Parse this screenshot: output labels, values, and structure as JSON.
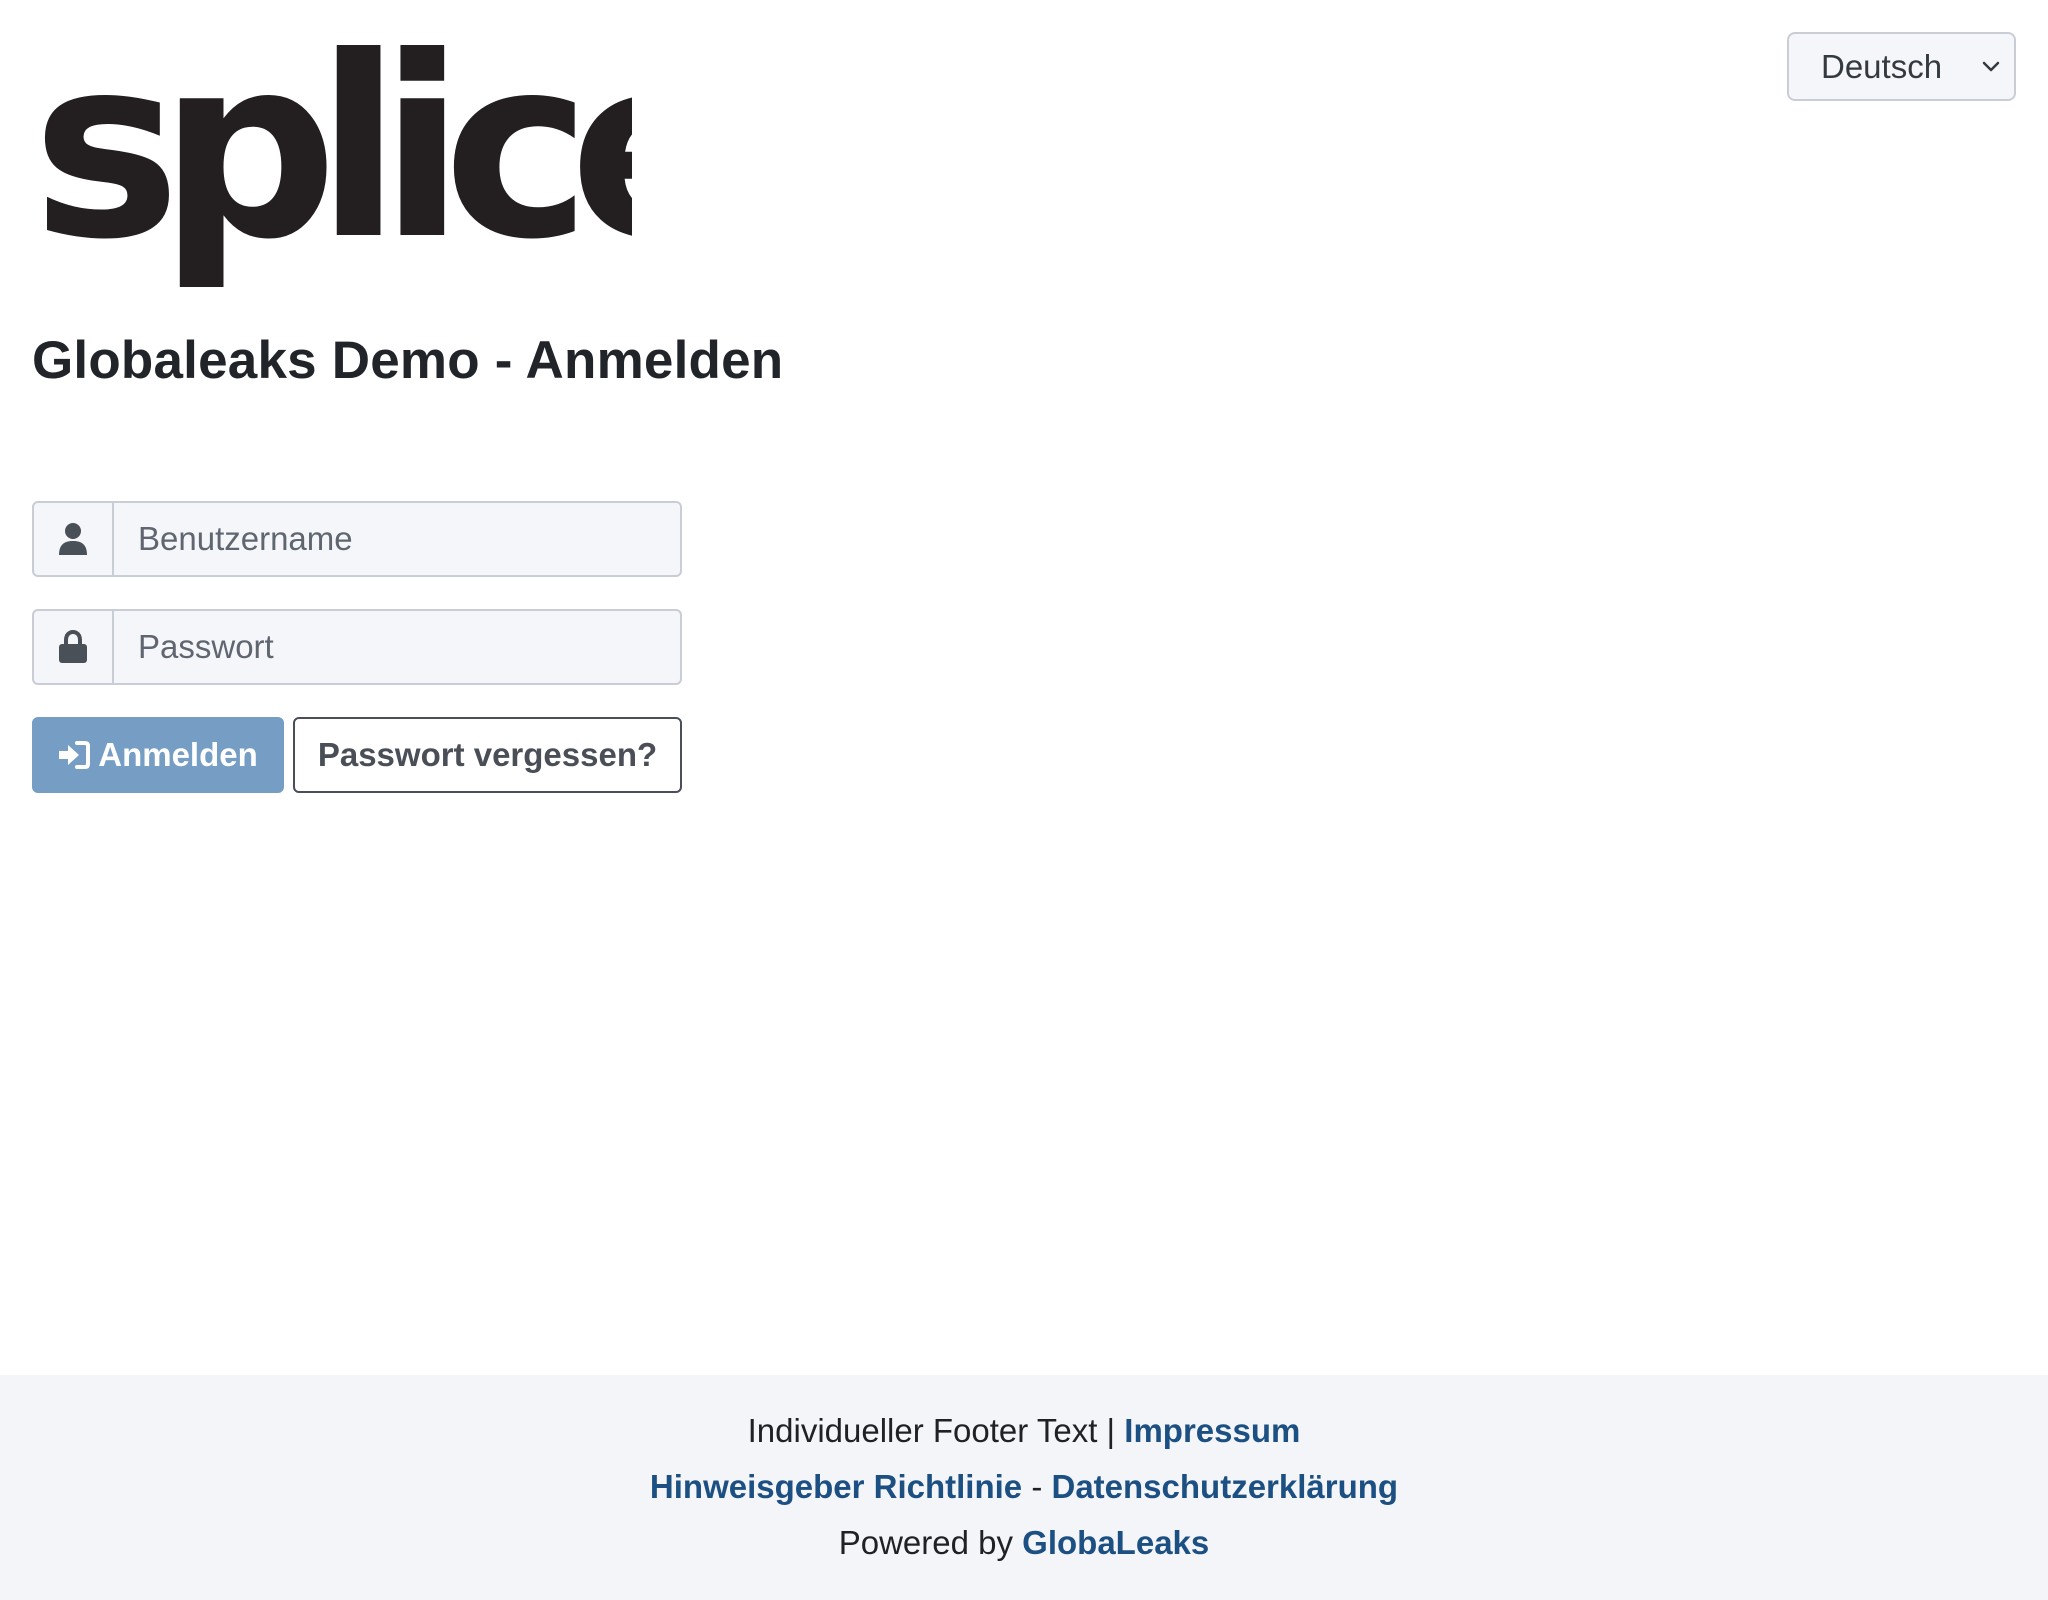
{
  "header": {
    "logo_alt": "splice",
    "language_select": {
      "value": "Deutsch",
      "icon": "chevron-down-icon"
    }
  },
  "main": {
    "title": "Globaleaks Demo - Anmelden",
    "username": {
      "placeholder": "Benutzername",
      "icon": "user-icon"
    },
    "password": {
      "placeholder": "Passwort",
      "icon": "lock-icon"
    },
    "login_button": {
      "label": "Anmelden",
      "icon": "sign-in-icon"
    },
    "forgot_button": {
      "label": "Passwort vergessen?"
    }
  },
  "footer": {
    "custom_text": "Individueller Footer Text",
    "separator": "|",
    "imprint_link": "Impressum",
    "whistleblower_policy_link": "Hinweisgeber Richtlinie",
    "dash": "-",
    "privacy_link": "Datenschutzerklärung",
    "powered_by_text": "Powered by",
    "globaleaks_link": "GlobaLeaks"
  },
  "colors": {
    "primary_button": "#769ec5",
    "link": "#1c4f82",
    "footer_bg": "#f4f5f9",
    "input_bg": "#f5f6fa"
  }
}
